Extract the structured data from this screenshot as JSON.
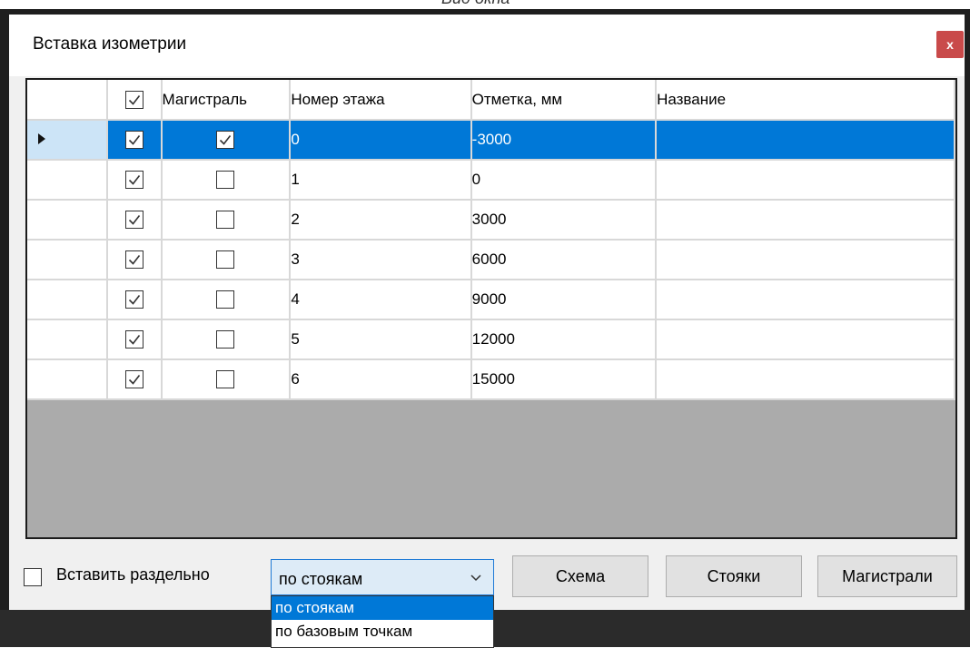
{
  "caption": "Вид окна",
  "window": {
    "title": "Вставка изометрии",
    "close_glyph": "x"
  },
  "grid": {
    "columns": [
      "",
      "",
      "Магистраль",
      "Номер этажа",
      "Отметка, мм",
      "Название"
    ],
    "header_checkbox_checked": true,
    "rows": [
      {
        "selected": true,
        "enabled": true,
        "main": true,
        "floor": "0",
        "mark": "-3000",
        "name": ""
      },
      {
        "selected": false,
        "enabled": true,
        "main": false,
        "floor": "1",
        "mark": "0",
        "name": ""
      },
      {
        "selected": false,
        "enabled": true,
        "main": false,
        "floor": "2",
        "mark": "3000",
        "name": ""
      },
      {
        "selected": false,
        "enabled": true,
        "main": false,
        "floor": "3",
        "mark": "6000",
        "name": ""
      },
      {
        "selected": false,
        "enabled": true,
        "main": false,
        "floor": "4",
        "mark": "9000",
        "name": ""
      },
      {
        "selected": false,
        "enabled": true,
        "main": false,
        "floor": "5",
        "mark": "12000",
        "name": ""
      },
      {
        "selected": false,
        "enabled": true,
        "main": false,
        "floor": "6",
        "mark": "15000",
        "name": ""
      }
    ]
  },
  "bottom": {
    "insert_separately_label": "Вставить раздельно",
    "insert_separately_checked": false,
    "mode_select": {
      "value": "по стоякам",
      "options": [
        "по стоякам",
        "по базовым точкам"
      ],
      "highlighted_index": 0
    },
    "buttons": {
      "scheme": "Схема",
      "risers": "Стояки",
      "mains": "Магистрали"
    }
  },
  "colors": {
    "selection": "#0078d7",
    "close_button": "#c94a4a",
    "row_header_selected": "#cce4f7"
  }
}
